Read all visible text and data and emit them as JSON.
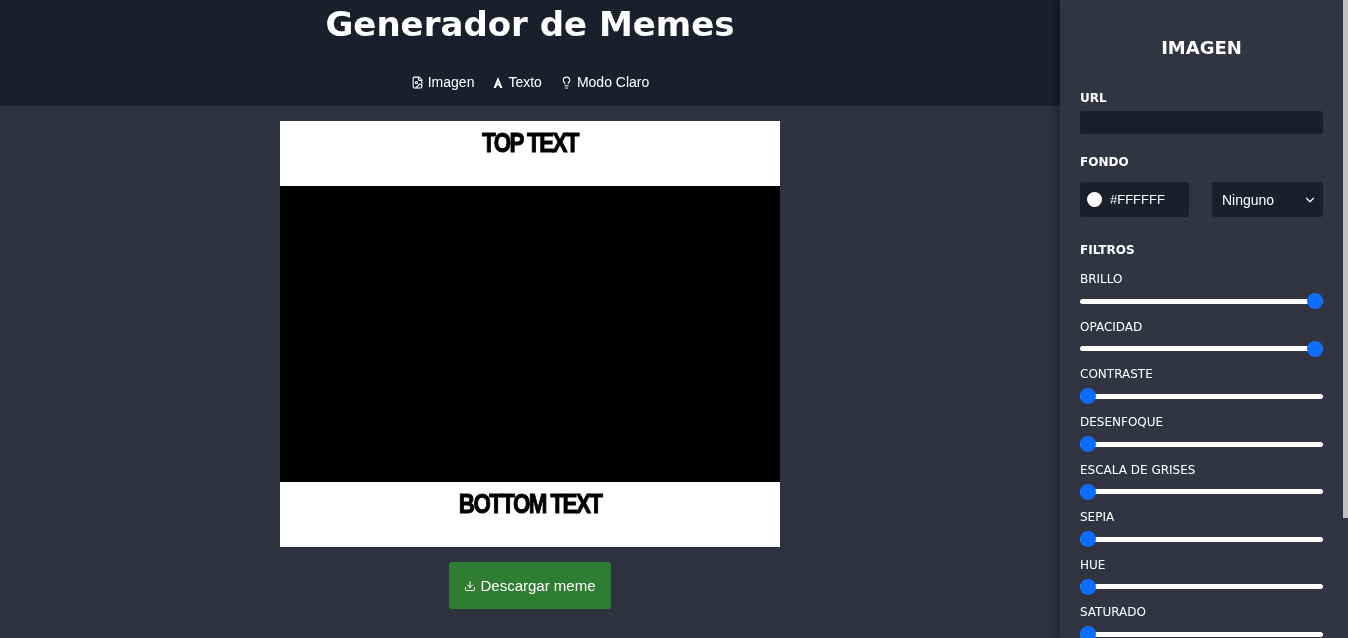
{
  "header": {
    "title": "Generador de Memes",
    "nav": [
      {
        "kind": "image",
        "label": "Imagen"
      },
      {
        "kind": "text",
        "label": "Texto"
      },
      {
        "kind": "theme",
        "label": "Modo Claro"
      }
    ]
  },
  "meme": {
    "top_text": "TOP TEXT",
    "bottom_text": "BOTTOM TEXT"
  },
  "download_button": "Descargar meme",
  "panel": {
    "title": "IMAGEN",
    "url_label": "URL",
    "background_label": "FONDO",
    "background_value": "#FFFFFF",
    "blend_mode": "Ninguno",
    "filters_label": "FILTROS",
    "filters": [
      {
        "label": "BRILLO",
        "level": 1
      },
      {
        "label": "OPACIDAD",
        "level": 1
      },
      {
        "label": "CONTRASTE",
        "level": 0
      },
      {
        "label": "DESENFOQUE",
        "level": 0
      },
      {
        "label": "ESCALA DE GRISES",
        "level": 0
      },
      {
        "label": "SEPIA",
        "level": 0
      },
      {
        "label": "HUE",
        "level": 0
      },
      {
        "label": "SATURADO",
        "level": 0
      }
    ]
  }
}
